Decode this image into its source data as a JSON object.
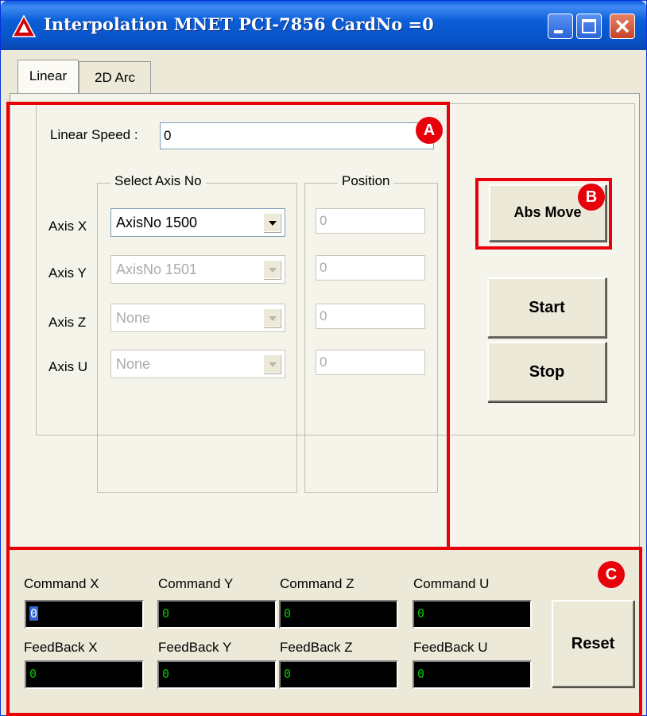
{
  "window": {
    "title": "Interpolation MNET PCI-7856 CardNo =0",
    "controls": [
      "minimize",
      "maximize",
      "close"
    ]
  },
  "tabs": [
    {
      "label": "Linear",
      "active": true
    },
    {
      "label": "2D Arc",
      "active": false
    }
  ],
  "linear": {
    "speed_label": "Linear Speed :",
    "speed_value": "0",
    "select_axis_legend": "Select Axis No",
    "position_legend": "Position",
    "axes": [
      {
        "label": "Axis X",
        "select": "AxisNo 1500",
        "enabled": true,
        "position": "0"
      },
      {
        "label": "Axis Y",
        "select": "AxisNo 1501",
        "enabled": false,
        "position": "0"
      },
      {
        "label": "Axis Z",
        "select": "None",
        "enabled": false,
        "position": "0"
      },
      {
        "label": "Axis U",
        "select": "None",
        "enabled": false,
        "position": "0"
      }
    ]
  },
  "buttons": {
    "abs_move": "Abs Move",
    "start": "Start",
    "stop": "Stop",
    "reset": "Reset"
  },
  "status": {
    "command": [
      {
        "label": "Command X",
        "value": "0"
      },
      {
        "label": "Command Y",
        "value": "0"
      },
      {
        "label": "Command Z",
        "value": "0"
      },
      {
        "label": "Command U",
        "value": "0"
      }
    ],
    "feedback": [
      {
        "label": "FeedBack X",
        "value": "0"
      },
      {
        "label": "FeedBack Y",
        "value": "0"
      },
      {
        "label": "FeedBack Z",
        "value": "0"
      },
      {
        "label": "FeedBack U",
        "value": "0"
      }
    ]
  },
  "annotations": {
    "a": "A",
    "b": "B",
    "c": "C",
    "color": "#e8000b"
  }
}
